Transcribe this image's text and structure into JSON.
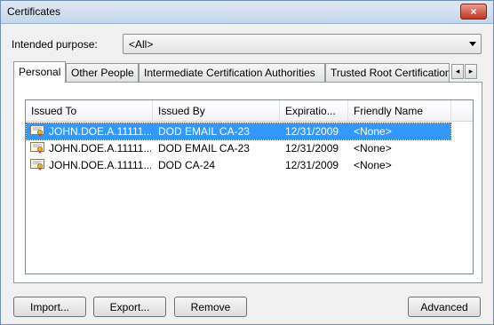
{
  "window": {
    "title": "Certificates",
    "close_label": "×"
  },
  "purpose": {
    "label": "Intended purpose:",
    "value": "<All>"
  },
  "tabs": [
    {
      "label": "Personal"
    },
    {
      "label": "Other People"
    },
    {
      "label": "Intermediate Certification Authorities"
    },
    {
      "label": "Trusted Root Certification"
    }
  ],
  "tab_scroll": {
    "left": "◂",
    "right": "▸"
  },
  "list": {
    "columns": [
      "Issued To",
      "Issued By",
      "Expiratio...",
      "Friendly Name"
    ],
    "rows": [
      {
        "issued_to": "JOHN.DOE.A.11111...",
        "issued_by": "DOD EMAIL CA-23",
        "expiration": "12/31/2009",
        "friendly_name": "<None>"
      },
      {
        "issued_to": "JOHN.DOE.A.11111...",
        "issued_by": "DOD EMAIL CA-23",
        "expiration": "12/31/2009",
        "friendly_name": "<None>"
      },
      {
        "issued_to": "JOHN.DOE.A.11111...",
        "issued_by": "DOD CA-24",
        "expiration": "12/31/2009",
        "friendly_name": "<None>"
      }
    ]
  },
  "buttons": {
    "import": "Import...",
    "export": "Export...",
    "remove": "Remove",
    "advanced": "Advanced"
  },
  "icons": {
    "certificate": "certificate-icon"
  },
  "colors": {
    "selection": "#3399ff",
    "close": "#c2361f"
  }
}
